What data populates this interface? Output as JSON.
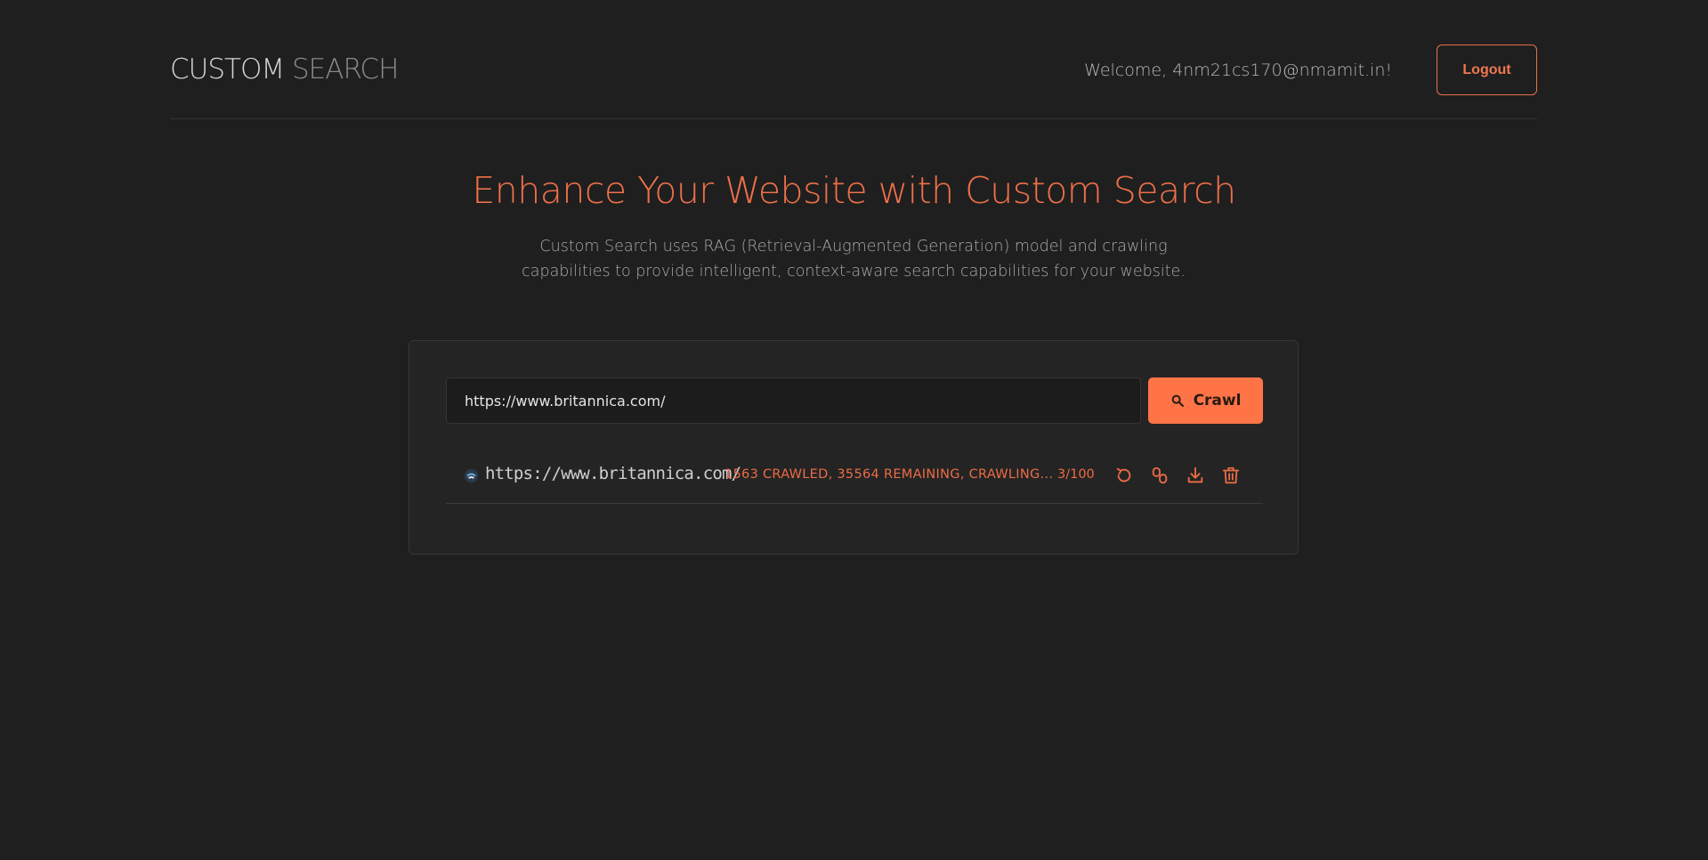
{
  "header": {
    "logo_part1": "CUSTOM",
    "logo_part2": "SEARCH",
    "welcome_text": "Welcome, 4nm21cs170@nmamit.in!",
    "logout_label": "Logout"
  },
  "hero": {
    "title": "Enhance Your Website with Custom Search",
    "description": "Custom Search uses RAG (Retrieval-Augmented Generation) model and crawling capabilities to provide intelligent, context-aware search capabilities for your website."
  },
  "crawl_form": {
    "url_value": "https://www.britannica.com/",
    "button_label": "Crawl",
    "button_icon": "search-icon"
  },
  "crawl_jobs": [
    {
      "favicon": "britannica-favicon",
      "url": "https://www.britannica.com/",
      "status": "1563 CRAWLED, 35564 REMAINING, CRAWLING...",
      "count": "3/100",
      "actions": [
        "refresh-icon",
        "link-icon",
        "download-icon",
        "trash-icon"
      ]
    }
  ],
  "colors": {
    "background": "#1f1f1f",
    "accent": "#ff7447",
    "card": "#242424"
  }
}
